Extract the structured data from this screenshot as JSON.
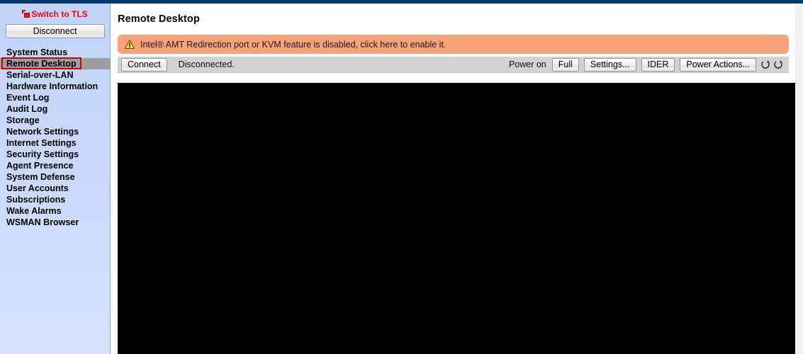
{
  "theme": {
    "topbar_color": "#04376b",
    "sidebar_bg": "#c6d6fb",
    "selected_row_bg": "#9e9e9e",
    "selection_outline": "#ce0000",
    "warning_bg": "#f7a37a",
    "toolbar_bg": "#d2d2d2",
    "canvas_color": "#000000",
    "link_color": "#fb0000"
  },
  "sidebar": {
    "tls_link": {
      "label": "Switch to TLS",
      "icon": "open-padlock-icon"
    },
    "disconnect_button": {
      "label": "Disconnect"
    },
    "items": [
      {
        "label": "System Status",
        "selected": false
      },
      {
        "label": "Remote Desktop",
        "selected": true
      },
      {
        "label": "Serial-over-LAN",
        "selected": false
      },
      {
        "label": "Hardware Information",
        "selected": false
      },
      {
        "label": "Event Log",
        "selected": false
      },
      {
        "label": "Audit Log",
        "selected": false
      },
      {
        "label": "Storage",
        "selected": false
      },
      {
        "label": "Network Settings",
        "selected": false
      },
      {
        "label": "Internet Settings",
        "selected": false
      },
      {
        "label": "Security Settings",
        "selected": false
      },
      {
        "label": "Agent Presence",
        "selected": false
      },
      {
        "label": "System Defense",
        "selected": false
      },
      {
        "label": "User Accounts",
        "selected": false
      },
      {
        "label": "Subscriptions",
        "selected": false
      },
      {
        "label": "Wake Alarms",
        "selected": false
      },
      {
        "label": "WSMAN Browser",
        "selected": false
      }
    ]
  },
  "main": {
    "title": "Remote Desktop",
    "warning": {
      "icon": "warning-triangle-icon",
      "text": "Intel® AMT Redirection port or KVM feature is disabled, click here to enable it."
    },
    "toolbar": {
      "connect_label": "Connect",
      "connection_status": "Disconnected.",
      "power_state_label": "Power on",
      "view_mode_label": "Full",
      "settings_label": "Settings...",
      "ider_label": "IDER",
      "power_actions_label": "Power Actions...",
      "refresh_icon": "refresh-icon",
      "reload_icon": "refresh-icon"
    },
    "canvas": {
      "state": "blank"
    }
  }
}
